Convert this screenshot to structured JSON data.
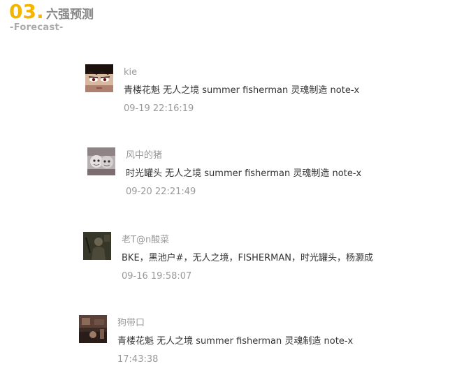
{
  "section": {
    "number": "03.",
    "title": "六强预测",
    "subtitle": "-Forecast-"
  },
  "colors": {
    "accent": "#f5b400",
    "title": "#888888",
    "subtitle": "#aaaaaa",
    "author": "#999999",
    "text": "#333333",
    "time": "#999999"
  },
  "comments": [
    {
      "author": "kie",
      "text": "青楼花魁 无人之境 summer fisherman 灵魂制造 note-x",
      "time": "09-19 22:16:19",
      "avatar_icon": "manga-face-avatar"
    },
    {
      "author": "风中的猪",
      "text": "时光罐头 无人之境 summer fisherman 灵魂制造 note-x",
      "time": "09-20 22:21:49",
      "avatar_icon": "masked-faces-avatar"
    },
    {
      "author": "老T@n酸菜",
      "text": "BKE，黑池户#，无人之境，FISHERMAN，时光罐头，杨灏成",
      "time": "09-16 19:58:07",
      "avatar_icon": "dark-photo-avatar"
    },
    {
      "author": "狗带口",
      "text": "青楼花魁 无人之境 summer fisherman 灵魂制造 note-x",
      "time": "17:43:38",
      "avatar_icon": "room-photo-avatar"
    }
  ]
}
